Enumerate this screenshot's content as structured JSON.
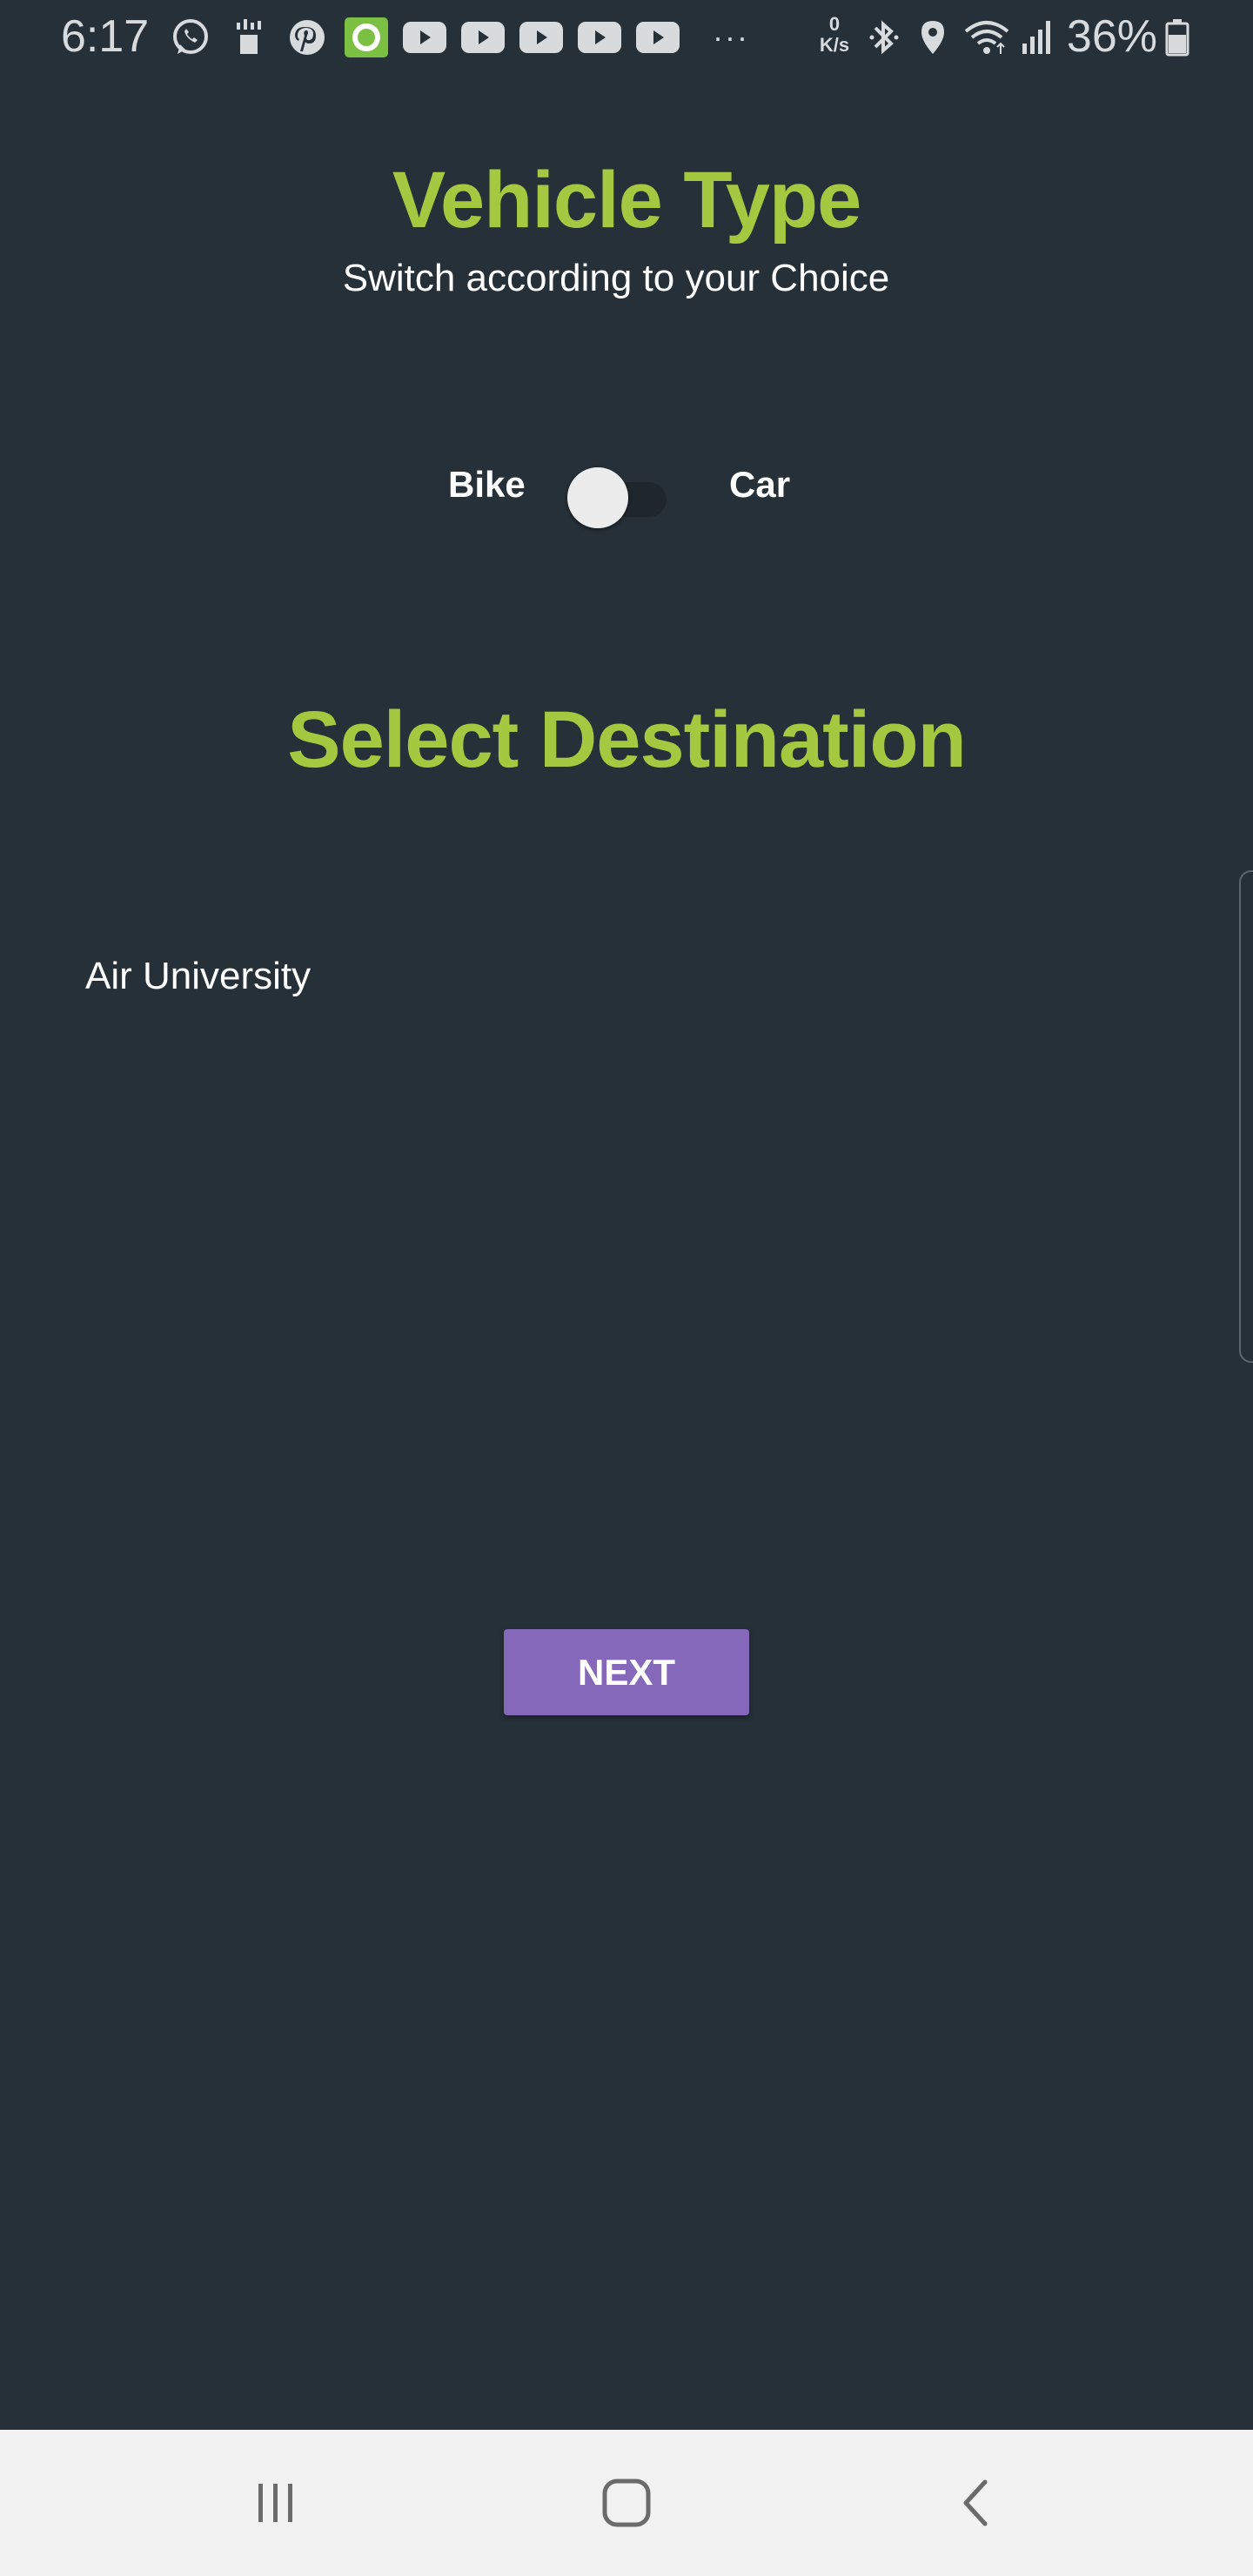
{
  "status_bar": {
    "time": "6:17",
    "network_speed": "0\nK/s",
    "battery_percent": "36%",
    "more_dots": "···",
    "icons": [
      "whatsapp-icon",
      "data-icon",
      "pinterest-icon",
      "green-app-icon",
      "youtube-icon",
      "youtube-icon",
      "youtube-icon",
      "youtube-icon",
      "youtube-icon",
      "bluetooth-icon",
      "location-icon",
      "wifi-icon",
      "signal-icon",
      "battery-icon"
    ]
  },
  "vehicle": {
    "title": "Vehicle Type",
    "subtitle": "Switch according to your Choice",
    "option_left": "Bike",
    "option_right": "Car",
    "toggle_on": false
  },
  "destination": {
    "title": "Select Destination",
    "selected": "Air University"
  },
  "actions": {
    "next_label": "NEXT"
  },
  "nav": {
    "icons": [
      "recent-apps-icon",
      "home-icon",
      "back-icon"
    ]
  },
  "colors": {
    "background": "#263038",
    "accent_green": "#a4c83f",
    "button_purple": "#8568b9",
    "nav_bar": "#f2f2f2"
  }
}
